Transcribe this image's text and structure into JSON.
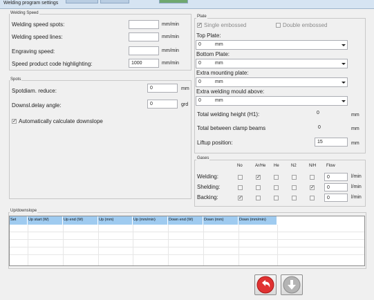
{
  "window": {
    "title": "Welding program settings"
  },
  "welding_speed": {
    "group_label": "Welding Speed",
    "rows": [
      {
        "label": "Welding speed spots:",
        "value": "",
        "unit": "mm/min"
      },
      {
        "label": "Welding speed lines:",
        "value": "",
        "unit": "mm/min"
      },
      {
        "label": "Engraving speed:",
        "value": "",
        "unit": "mm/min"
      },
      {
        "label": "Speed product code highlighting:",
        "value": "1000",
        "unit": "mm/min"
      }
    ]
  },
  "spots": {
    "group_label": "Spots",
    "rows": [
      {
        "label": "Spotdiam. reduce:",
        "value": "0",
        "unit": "mm"
      },
      {
        "label": "Downsl.delay angle:",
        "value": "0",
        "unit": "grd"
      }
    ],
    "auto_label": "Automatically calculate downslope",
    "auto_checked": true
  },
  "plate": {
    "group_label": "Plate",
    "single_label": "Single embossed",
    "single_checked": true,
    "double_label": "Double embossed",
    "double_checked": false,
    "combos": [
      {
        "label": "Top Plate:",
        "value": "0",
        "unit": "mm"
      },
      {
        "label": "Bottom Plate:",
        "value": "0",
        "unit": "mm"
      },
      {
        "label": "Extra mounting plate:",
        "value": "0",
        "unit": "mm"
      },
      {
        "label": "Extra welding mould above:",
        "value": "0",
        "unit": "mm"
      }
    ],
    "total_height_label": "Total welding height (H1):",
    "total_height_value": "0",
    "total_height_unit": "mm",
    "clamp_label": "Total between clamp beams",
    "clamp_value": "0",
    "clamp_unit": "mm",
    "liftup_label": "Liftup position:",
    "liftup_value": "15",
    "liftup_unit": "mm"
  },
  "gases": {
    "group_label": "Gases",
    "columns": [
      "No",
      "Ar/He",
      "He",
      "N2",
      "N/H",
      "Flow"
    ],
    "rows": [
      {
        "label": "Welding:",
        "checks": [
          false,
          true,
          false,
          false,
          false
        ],
        "flow": "0",
        "unit": "l/min"
      },
      {
        "label": "Shelding:",
        "checks": [
          false,
          false,
          false,
          false,
          true
        ],
        "flow": "0",
        "unit": "l/min"
      },
      {
        "label": "Backing:",
        "checks": [
          true,
          false,
          false,
          false,
          false
        ],
        "flow": "0",
        "unit": "l/min"
      }
    ]
  },
  "updown": {
    "group_label": "Up/downslope",
    "columns": [
      "Set",
      "Up start (W)",
      "Up end (W)",
      "Up (mm)",
      "Up (mm/min)",
      "Down end (W)",
      "Down (mm)",
      "Down (mm/min)"
    ]
  },
  "buttons": {
    "back_icon": "undo-arrow-icon",
    "down_icon": "down-arrow-icon"
  },
  "colors": {
    "header_blue": "#9fcbf0",
    "back_red": "#e03232",
    "disabled_gray": "#b4b4b4"
  }
}
